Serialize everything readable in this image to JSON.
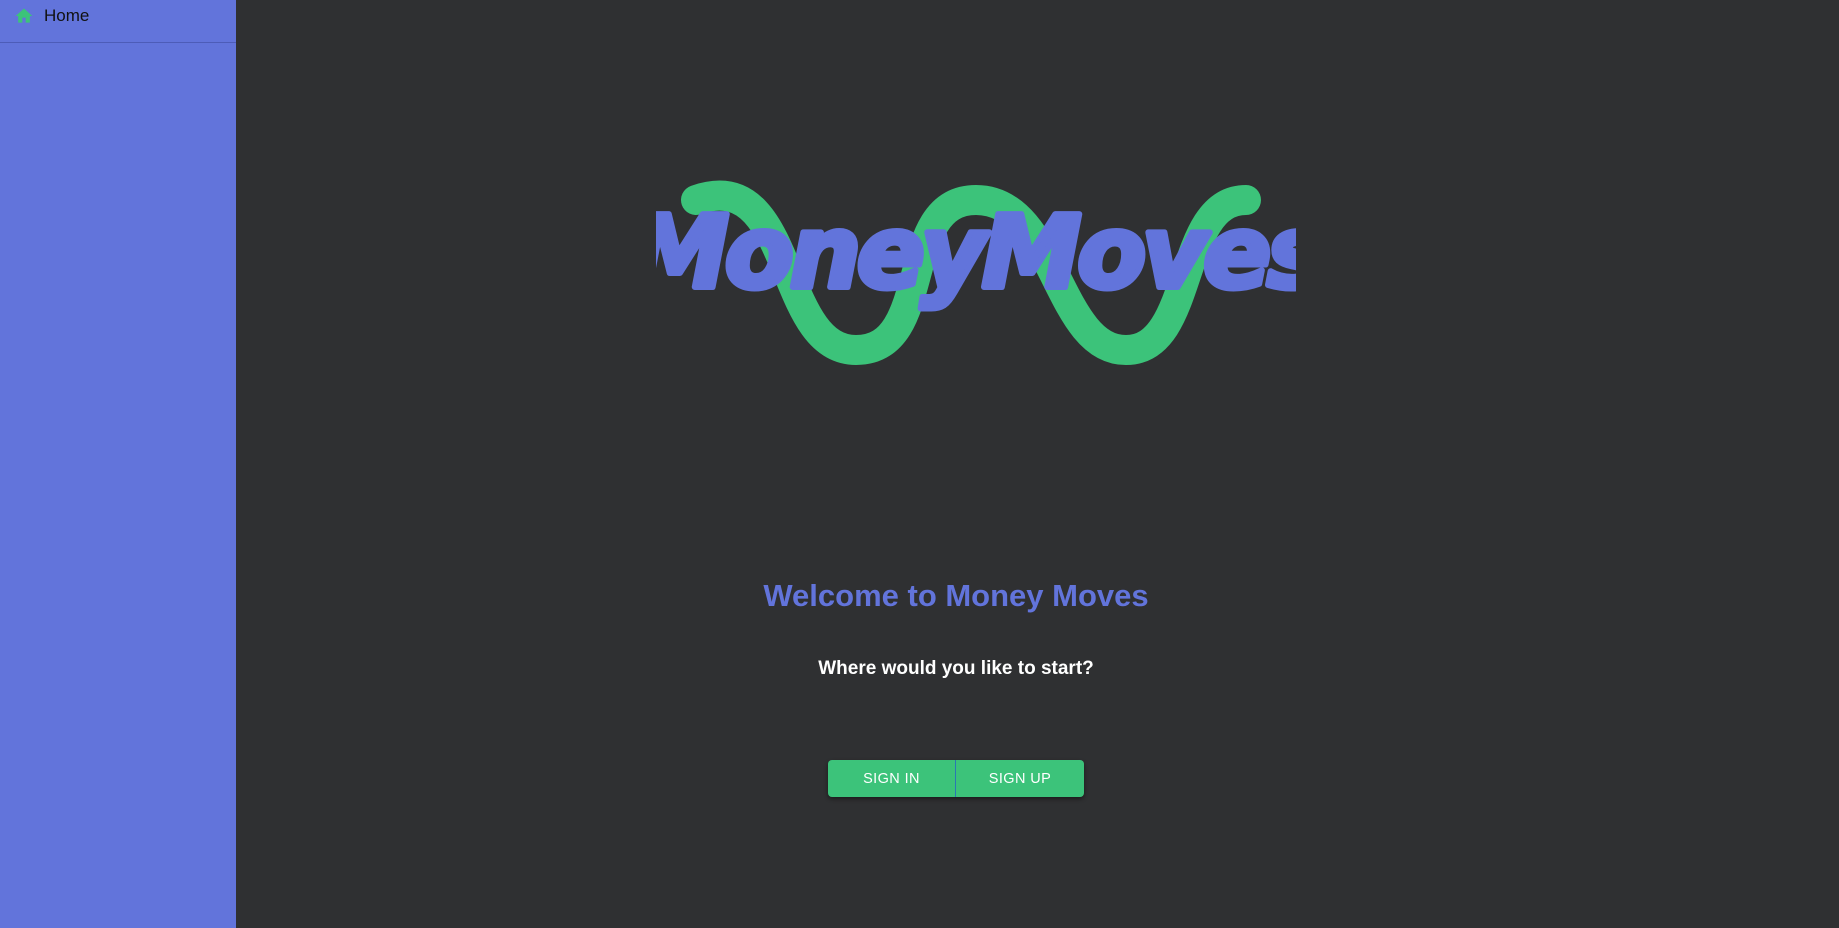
{
  "sidebar": {
    "items": [
      {
        "label": "Home",
        "icon": "home-icon"
      }
    ]
  },
  "main": {
    "logo_text": "MoneyMoves",
    "welcome": "Welcome to Money Moves",
    "subtitle": "Where would you like to start?",
    "buttons": {
      "sign_in": "SIGN IN",
      "sign_up": "SIGN UP"
    }
  },
  "colors": {
    "brand_blue": "#6274db",
    "brand_green": "#3cc37a",
    "background": "#2f3032"
  }
}
